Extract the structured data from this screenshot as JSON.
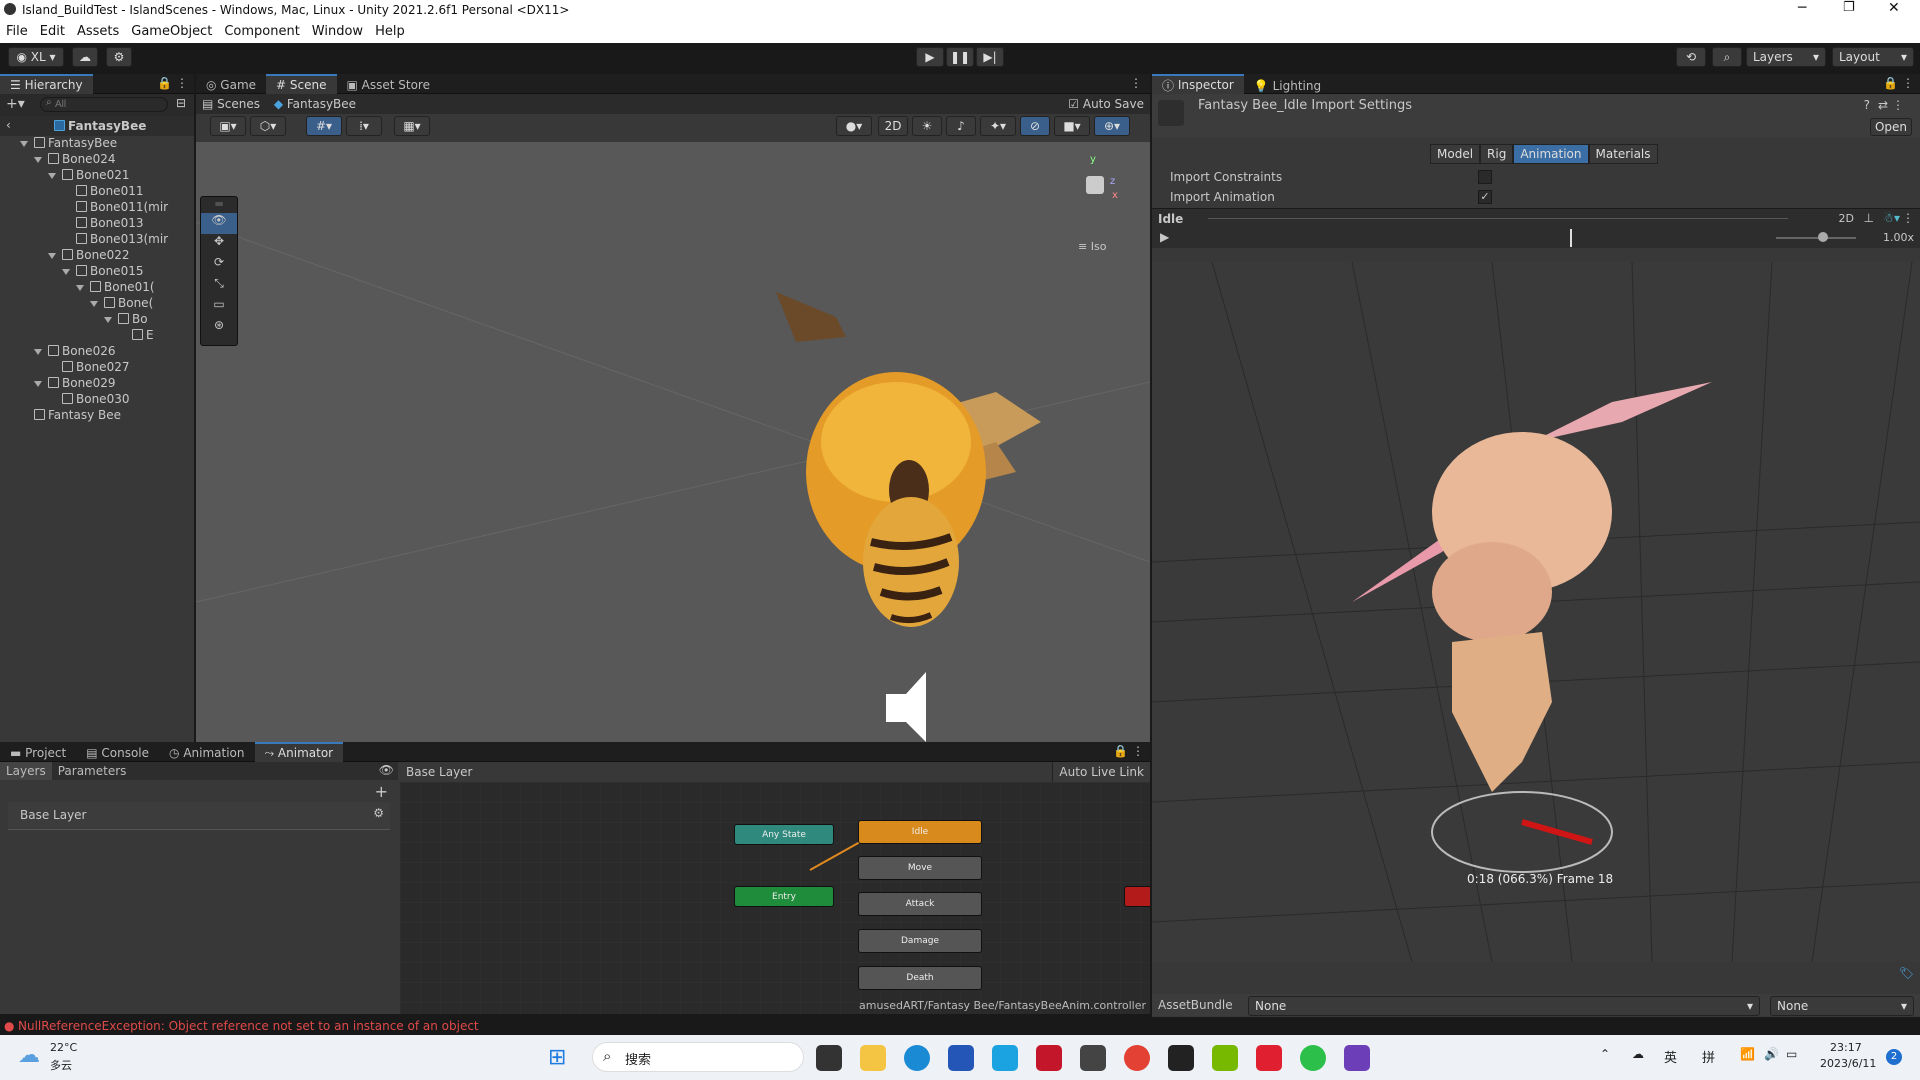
{
  "window": {
    "title": "Island_BuildTest - IslandScenes - Windows, Mac, Linux - Unity 2021.2.6f1 Personal <DX11>"
  },
  "menu": [
    "File",
    "Edit",
    "Assets",
    "GameObject",
    "Component",
    "Window",
    "Help"
  ],
  "toolbar": {
    "account": "XL",
    "layers": "Layers",
    "layout": "Layout"
  },
  "hierarchy": {
    "tab": "Hierarchy",
    "search_placeholder": "All",
    "root": "FantasyBee",
    "items": [
      {
        "label": "FantasyBee",
        "depth": 1,
        "arrow": true
      },
      {
        "label": "Bone024",
        "depth": 2,
        "arrow": true
      },
      {
        "label": "Bone021",
        "depth": 3,
        "arrow": true
      },
      {
        "label": "Bone011",
        "depth": 4,
        "arrow": false
      },
      {
        "label": "Bone011(mir",
        "depth": 4,
        "arrow": false
      },
      {
        "label": "Bone013",
        "depth": 4,
        "arrow": false
      },
      {
        "label": "Bone013(mir",
        "depth": 4,
        "arrow": false
      },
      {
        "label": "Bone022",
        "depth": 3,
        "arrow": true
      },
      {
        "label": "Bone015",
        "depth": 4,
        "arrow": true
      },
      {
        "label": "Bone01(",
        "depth": 5,
        "arrow": true
      },
      {
        "label": "Bone(",
        "depth": 6,
        "arrow": true
      },
      {
        "label": "Bo",
        "depth": 7,
        "arrow": true
      },
      {
        "label": "E",
        "depth": 8,
        "arrow": false
      },
      {
        "label": "Bone026",
        "depth": 2,
        "arrow": true
      },
      {
        "label": "Bone027",
        "depth": 3,
        "arrow": false
      },
      {
        "label": "Bone029",
        "depth": 2,
        "arrow": true
      },
      {
        "label": "Bone030",
        "depth": 3,
        "arrow": false
      },
      {
        "label": "Fantasy Bee",
        "depth": 1,
        "arrow": false
      }
    ]
  },
  "scene": {
    "tabs": [
      "Game",
      "Scene",
      "Asset Store"
    ],
    "breadcrumb": [
      "Scenes",
      "FantasyBee"
    ],
    "auto_save": "Auto Save",
    "btn_2d": "2D",
    "iso": "Iso"
  },
  "bottom": {
    "tabs": [
      "Project",
      "Console",
      "Animation",
      "Animator"
    ],
    "subtabs": [
      "Layers",
      "Parameters"
    ],
    "layer": "Base Layer",
    "crumb": "Base Layer",
    "live_link": "Auto Live Link",
    "path": "amusedART/Fantasy Bee/FantasyBeeAnim.controller",
    "nodes": {
      "any": "Any State",
      "entry": "Entry",
      "idle": "Idle",
      "move": "Move",
      "attack": "Attack",
      "damage": "Damage",
      "death": "Death"
    }
  },
  "inspector": {
    "tabs": [
      "Inspector",
      "Lighting"
    ],
    "title": "Fantasy Bee_Idle Import Settings",
    "open": "Open",
    "subtabs": [
      "Model",
      "Rig",
      "Animation",
      "Materials"
    ],
    "active_subtab": "Animation",
    "import_constraints": "Import Constraints",
    "import_constraints_checked": false,
    "import_animation": "Import Animation",
    "import_animation_checked": true,
    "clip": "Idle",
    "btn_2d": "2D",
    "speed": "1.00x",
    "preview": "0:18 (066.3%) Frame 18",
    "assetbundle_label": "AssetBundle",
    "assetbundle_value": "None",
    "variant_value": "None"
  },
  "status": {
    "error": "NullReferenceException: Object reference not set to an instance of an object"
  },
  "taskbar": {
    "temp": "22°C",
    "weather": "多云",
    "search": "搜索",
    "ime1": "英",
    "ime2": "拼",
    "time": "23:17",
    "date": "2023/6/11",
    "badge": "2"
  }
}
